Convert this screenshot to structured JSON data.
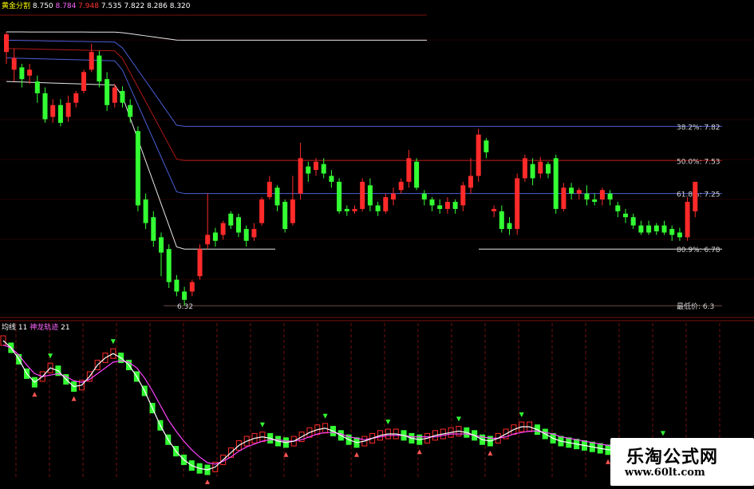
{
  "colors": {
    "background": "#000000",
    "up_candle": "#ff2a2a",
    "down_candle": "#33ff33",
    "grid_red": "#7a1010",
    "level_white": "#e8e8e8",
    "level_blue": "#4a5fd8",
    "level_red": "#b01818",
    "level_dim": "#6a4a4a",
    "label": "#d8d8d8",
    "header_yellow": "#ffff00",
    "header_magenta": "#ff66ff",
    "header_white": "#ffffff",
    "ma_magenta": "#ff44ff",
    "ma_white": "#ffffff",
    "arrow_green": "#33ff33",
    "arrow_red": "#ff5555"
  },
  "top_header": {
    "title": "黄金分割",
    "v1": "8.750",
    "v2": "8.784",
    "v3": "7.948",
    "v4": "7.535",
    "v5": "7.822",
    "v6": "8.286",
    "v7": "8.320"
  },
  "bottom_header": {
    "title": "均线",
    "v1": "11",
    "label2": "神龙轨迹",
    "v2": "21"
  },
  "watermark": {
    "brand": "乐淘公式网",
    "url": "www.60lt.com"
  },
  "chart_data": [
    {
      "type": "candlestick",
      "title": "黄金分割",
      "ylim": [
        6.2,
        8.85
      ],
      "levels": [
        {
          "label": "38.2%:",
          "value": 7.82
        },
        {
          "label": "50.0%:",
          "value": 7.53
        },
        {
          "label": "61.8%:",
          "value": 7.25
        },
        {
          "label": "80.9%:",
          "value": 6.78
        },
        {
          "label": "最低价:",
          "value": 6.3
        }
      ],
      "low_marker": "6.32",
      "candles": [
        [
          8.45,
          8.6,
          8.35,
          8.62
        ],
        [
          8.3,
          8.4,
          8.2,
          8.48
        ],
        [
          8.32,
          8.22,
          8.15,
          8.35
        ],
        [
          8.25,
          8.3,
          8.18,
          8.35
        ],
        [
          8.2,
          8.1,
          8.02,
          8.25
        ],
        [
          8.1,
          7.88,
          7.85,
          8.15
        ],
        [
          7.9,
          8.0,
          7.85,
          8.05
        ],
        [
          8.0,
          7.85,
          7.82,
          8.05
        ],
        [
          7.9,
          8.02,
          7.86,
          8.08
        ],
        [
          8.02,
          8.1,
          7.98,
          8.12
        ],
        [
          8.12,
          8.28,
          8.1,
          8.3
        ],
        [
          8.3,
          8.45,
          8.28,
          8.52
        ],
        [
          8.42,
          8.2,
          8.15,
          8.46
        ],
        [
          8.22,
          8.0,
          7.95,
          8.28
        ],
        [
          8.02,
          8.15,
          7.98,
          8.18
        ],
        [
          8.12,
          8.02,
          7.98,
          8.16
        ],
        [
          8.0,
          7.9,
          7.85,
          8.05
        ],
        [
          7.78,
          7.15,
          7.1,
          7.82
        ],
        [
          7.2,
          7.0,
          6.95,
          7.25
        ],
        [
          7.05,
          6.85,
          6.8,
          7.1
        ],
        [
          6.88,
          6.75,
          6.55,
          6.92
        ],
        [
          6.78,
          6.5,
          6.45,
          6.82
        ],
        [
          6.52,
          6.42,
          6.38,
          6.56
        ],
        [
          6.42,
          6.35,
          6.3,
          6.46
        ],
        [
          6.42,
          6.5,
          6.38,
          6.52
        ],
        [
          6.55,
          6.78,
          6.52,
          6.82
        ],
        [
          6.82,
          6.9,
          6.78,
          7.25
        ],
        [
          6.92,
          6.85,
          6.8,
          6.96
        ],
        [
          6.9,
          7.0,
          6.86,
          7.02
        ],
        [
          7.08,
          6.98,
          6.95,
          7.1
        ],
        [
          7.05,
          6.92,
          6.88,
          7.08
        ],
        [
          6.95,
          6.85,
          6.8,
          6.98
        ],
        [
          6.88,
          6.95,
          6.85,
          7.0
        ],
        [
          7.0,
          7.2,
          6.98,
          7.22
        ],
        [
          7.22,
          7.35,
          7.2,
          7.4
        ],
        [
          7.3,
          7.15,
          7.1,
          7.32
        ],
        [
          7.18,
          6.95,
          6.92,
          7.2
        ],
        [
          7.0,
          7.2,
          6.98,
          7.4
        ],
        [
          7.25,
          7.55,
          7.2,
          7.68
        ],
        [
          7.48,
          7.42,
          7.35,
          7.52
        ],
        [
          7.45,
          7.52,
          7.4,
          7.55
        ],
        [
          7.5,
          7.42,
          7.38,
          7.55
        ],
        [
          7.4,
          7.35,
          7.3,
          7.45
        ],
        [
          7.35,
          7.1,
          7.08,
          7.38
        ],
        [
          7.12,
          7.1,
          7.06,
          7.15
        ],
        [
          7.1,
          7.12,
          7.08,
          7.15
        ],
        [
          7.12,
          7.35,
          7.1,
          7.38
        ],
        [
          7.32,
          7.15,
          7.1,
          7.38
        ],
        [
          7.15,
          7.1,
          7.06,
          7.18
        ],
        [
          7.1,
          7.22,
          7.08,
          7.25
        ],
        [
          7.2,
          7.25,
          7.15,
          7.3
        ],
        [
          7.28,
          7.35,
          7.25,
          7.38
        ],
        [
          7.35,
          7.55,
          7.3,
          7.62
        ],
        [
          7.52,
          7.3,
          7.28,
          7.55
        ],
        [
          7.25,
          7.2,
          7.15,
          7.28
        ],
        [
          7.2,
          7.15,
          7.1,
          7.22
        ],
        [
          7.15,
          7.12,
          7.08,
          7.2
        ],
        [
          7.12,
          7.18,
          7.08,
          7.22
        ],
        [
          7.18,
          7.12,
          7.08,
          7.2
        ],
        [
          7.15,
          7.32,
          7.1,
          7.35
        ],
        [
          7.3,
          7.4,
          7.25,
          7.55
        ],
        [
          7.4,
          7.75,
          7.35,
          7.8
        ],
        [
          7.7,
          7.6,
          7.55,
          7.72
        ],
        [
          7.1,
          7.12,
          7.05,
          7.15
        ],
        [
          7.1,
          6.95,
          6.92,
          7.15
        ],
        [
          7.0,
          6.95,
          6.9,
          7.05
        ],
        [
          6.95,
          7.38,
          6.9,
          7.42
        ],
        [
          7.38,
          7.55,
          7.35,
          7.58
        ],
        [
          7.5,
          7.38,
          7.32,
          7.55
        ],
        [
          7.42,
          7.52,
          7.38,
          7.56
        ],
        [
          7.5,
          7.42,
          7.38,
          7.52
        ],
        [
          7.55,
          7.12,
          7.08,
          7.58
        ],
        [
          7.12,
          7.3,
          7.1,
          7.34
        ],
        [
          7.3,
          7.25,
          7.2,
          7.34
        ],
        [
          7.25,
          7.28,
          7.2,
          7.3
        ],
        [
          7.25,
          7.2,
          7.15,
          7.32
        ],
        [
          7.2,
          7.18,
          7.15,
          7.25
        ],
        [
          7.2,
          7.28,
          7.15,
          7.3
        ],
        [
          7.25,
          7.2,
          7.15,
          7.28
        ],
        [
          7.15,
          7.1,
          7.05,
          7.18
        ],
        [
          7.08,
          7.05,
          7.0,
          7.12
        ],
        [
          7.05,
          6.98,
          6.95,
          7.08
        ],
        [
          6.98,
          6.92,
          6.9,
          7.02
        ],
        [
          6.98,
          6.92,
          6.9,
          7.02
        ],
        [
          6.98,
          6.93,
          6.9,
          7.0
        ],
        [
          6.98,
          6.92,
          6.9,
          7.02
        ],
        [
          6.95,
          6.9,
          6.85,
          6.98
        ],
        [
          6.92,
          6.88,
          6.85,
          6.96
        ],
        [
          6.88,
          7.18,
          6.85,
          7.22
        ],
        [
          7.1,
          7.35,
          7.05,
          7.35
        ]
      ]
    },
    {
      "type": "line",
      "title": "均线",
      "series": [
        {
          "name": "均线",
          "values": [
            0.95,
            0.9,
            0.82,
            0.72,
            0.66,
            0.7,
            0.76,
            0.74,
            0.68,
            0.63,
            0.64,
            0.7,
            0.78,
            0.83,
            0.86,
            0.83,
            0.78,
            0.7,
            0.6,
            0.48,
            0.36,
            0.26,
            0.18,
            0.12,
            0.08,
            0.06,
            0.05,
            0.07,
            0.12,
            0.17,
            0.22,
            0.25,
            0.27,
            0.28,
            0.27,
            0.25,
            0.24,
            0.25,
            0.28,
            0.31,
            0.33,
            0.34,
            0.32,
            0.29,
            0.26,
            0.24,
            0.25,
            0.27,
            0.29,
            0.3,
            0.3,
            0.29,
            0.27,
            0.26,
            0.27,
            0.29,
            0.3,
            0.31,
            0.32,
            0.31,
            0.29,
            0.26,
            0.25,
            0.27,
            0.3,
            0.33,
            0.35,
            0.35,
            0.33,
            0.3,
            0.27,
            0.25,
            0.24,
            0.23,
            0.22,
            0.21,
            0.2,
            0.19,
            0.19,
            0.18,
            0.18,
            0.18,
            0.19,
            0.21,
            0.22,
            0.2,
            0.18,
            0.17,
            0.17,
            0.18,
            0.2
          ]
        },
        {
          "name": "神龙轨迹",
          "values": [
            0.92,
            0.9,
            0.85,
            0.78,
            0.72,
            0.7,
            0.71,
            0.72,
            0.7,
            0.67,
            0.66,
            0.68,
            0.72,
            0.76,
            0.8,
            0.81,
            0.8,
            0.76,
            0.69,
            0.6,
            0.5,
            0.4,
            0.32,
            0.25,
            0.19,
            0.14,
            0.1,
            0.09,
            0.11,
            0.14,
            0.18,
            0.21,
            0.23,
            0.25,
            0.26,
            0.26,
            0.25,
            0.25,
            0.26,
            0.28,
            0.3,
            0.31,
            0.31,
            0.3,
            0.28,
            0.27,
            0.26,
            0.27,
            0.28,
            0.29,
            0.29,
            0.29,
            0.28,
            0.28,
            0.28,
            0.28,
            0.29,
            0.3,
            0.3,
            0.3,
            0.29,
            0.28,
            0.27,
            0.27,
            0.28,
            0.3,
            0.31,
            0.32,
            0.32,
            0.31,
            0.3,
            0.28,
            0.27,
            0.26,
            0.25,
            0.24,
            0.23,
            0.22,
            0.21,
            0.21,
            0.2,
            0.2,
            0.2,
            0.2,
            0.2,
            0.2,
            0.19,
            0.19,
            0.19,
            0.19,
            0.19
          ]
        }
      ]
    }
  ]
}
